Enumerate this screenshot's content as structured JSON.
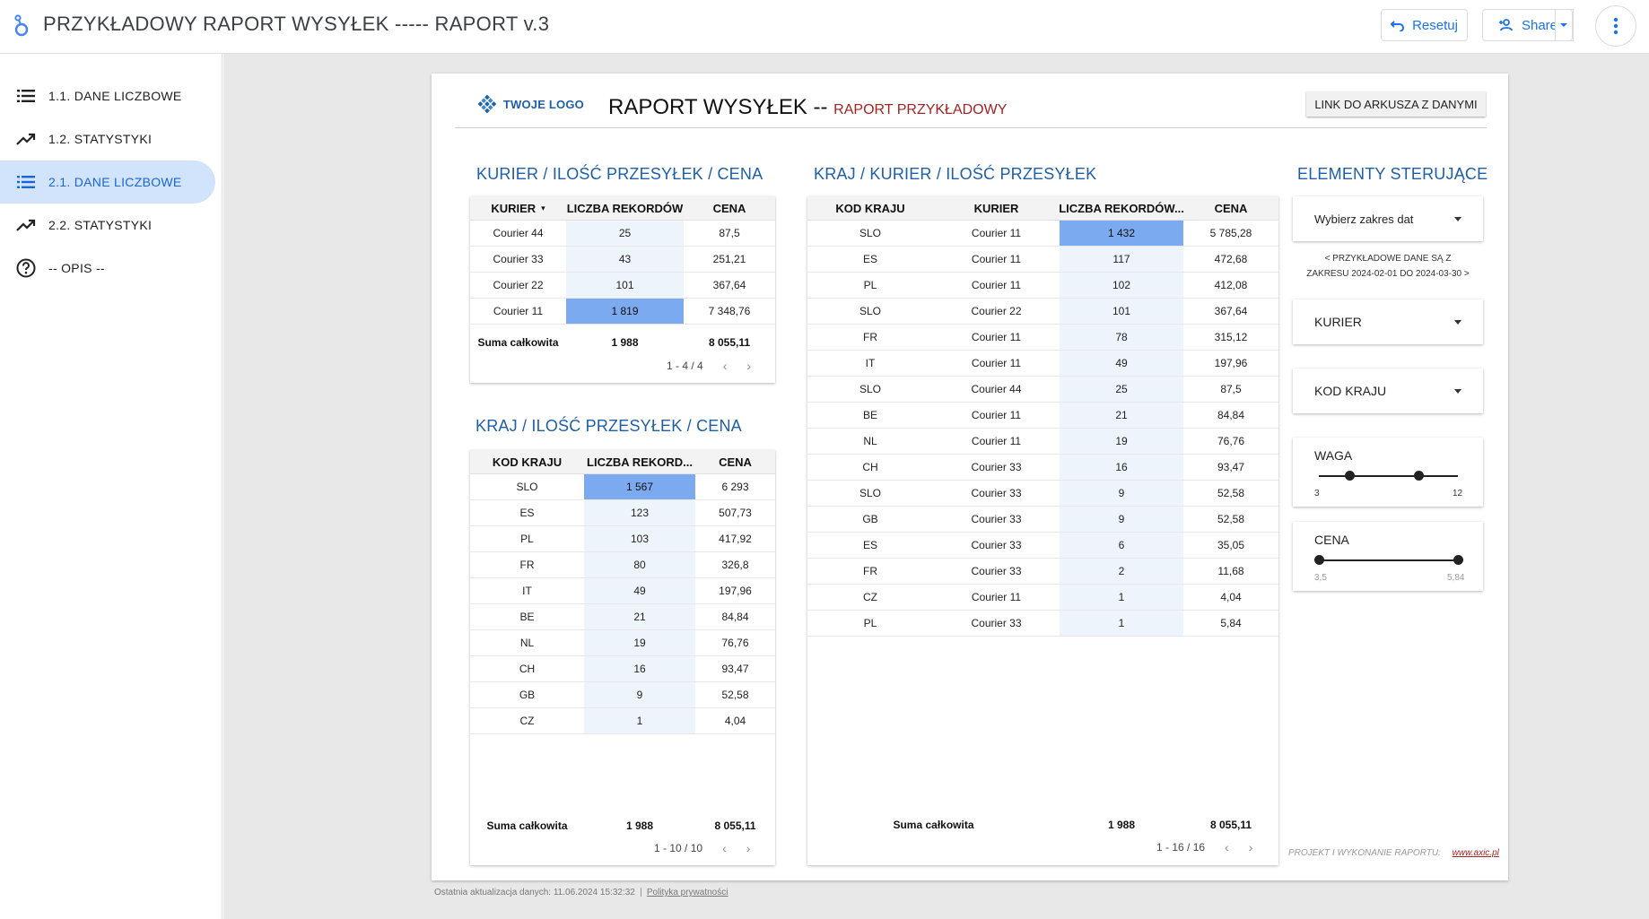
{
  "app": {
    "title": "PRZYKŁADOWY RAPORT WYSYŁEK ----- RAPORT v.3",
    "reset_label": "Resetuj",
    "share_label": "Share"
  },
  "sidebar": {
    "items": [
      {
        "label": "1.1. DANE LICZBOWE",
        "icon": "list-icon",
        "active": false
      },
      {
        "label": "1.2. STATYSTYKI",
        "icon": "trending-up-icon",
        "active": false
      },
      {
        "label": "2.1. DANE LICZBOWE",
        "icon": "list-icon",
        "active": true
      },
      {
        "label": "2.2. STATYSTYKI",
        "icon": "trending-up-icon",
        "active": false
      },
      {
        "label": "-- OPIS --",
        "icon": "help-circle-icon",
        "active": false
      }
    ]
  },
  "report": {
    "logo_text": "TWOJE LOGO",
    "title": "RAPORT WYSYŁEK --",
    "subtitle": "RAPORT PRZYKŁADOWY",
    "link_button": "LINK DO ARKUSZA Z DANYMI",
    "credits_label": "PROJEKT I WYKONANIE RAPORTU:",
    "credits_url": "www.axic.pl"
  },
  "table_courier": {
    "title": "KURIER / ILOŚĆ PRZESYŁEK / CENA",
    "headers": [
      "KURIER",
      "LICZBA REKORDÓW",
      "CENA"
    ],
    "sort_indicator": "▾",
    "rows": [
      [
        "Courier 44",
        "25",
        "87,5"
      ],
      [
        "Courier 33",
        "43",
        "251,21"
      ],
      [
        "Courier 22",
        "101",
        "367,64"
      ],
      [
        "Courier 11",
        "1 819",
        "7 348,76"
      ]
    ],
    "counts": [
      25,
      43,
      101,
      1819
    ],
    "total_label": "Suma całkowita",
    "total_count": "1 988",
    "total_price": "8 055,11",
    "pager": "1 - 4 / 4"
  },
  "table_country": {
    "title": "KRAJ / ILOŚĆ PRZESYŁEK / CENA",
    "headers": [
      "KOD KRAJU",
      "LICZBA REKORD...",
      "CENA"
    ],
    "rows": [
      [
        "SLO",
        "1 567",
        "6 293"
      ],
      [
        "ES",
        "123",
        "507,73"
      ],
      [
        "PL",
        "103",
        "417,92"
      ],
      [
        "FR",
        "80",
        "326,8"
      ],
      [
        "IT",
        "49",
        "197,96"
      ],
      [
        "BE",
        "21",
        "84,84"
      ],
      [
        "NL",
        "19",
        "76,76"
      ],
      [
        "CH",
        "16",
        "93,47"
      ],
      [
        "GB",
        "9",
        "52,58"
      ],
      [
        "CZ",
        "1",
        "4,04"
      ]
    ],
    "counts": [
      1567,
      123,
      103,
      80,
      49,
      21,
      19,
      16,
      9,
      1
    ],
    "total_label": "Suma całkowita",
    "total_count": "1 988",
    "total_price": "8 055,11",
    "pager": "1 - 10 / 10"
  },
  "table_country_courier": {
    "title": "KRAJ / KURIER / ILOŚĆ PRZESYŁEK",
    "headers": [
      "KOD KRAJU",
      "KURIER",
      "LICZBA REKORDÓW...",
      "CENA"
    ],
    "rows": [
      [
        "SLO",
        "Courier 11",
        "1 432",
        "5 785,28"
      ],
      [
        "ES",
        "Courier 11",
        "117",
        "472,68"
      ],
      [
        "PL",
        "Courier 11",
        "102",
        "412,08"
      ],
      [
        "SLO",
        "Courier 22",
        "101",
        "367,64"
      ],
      [
        "FR",
        "Courier 11",
        "78",
        "315,12"
      ],
      [
        "IT",
        "Courier 11",
        "49",
        "197,96"
      ],
      [
        "SLO",
        "Courier 44",
        "25",
        "87,5"
      ],
      [
        "BE",
        "Courier 11",
        "21",
        "84,84"
      ],
      [
        "NL",
        "Courier 11",
        "19",
        "76,76"
      ],
      [
        "CH",
        "Courier 33",
        "16",
        "93,47"
      ],
      [
        "SLO",
        "Courier 33",
        "9",
        "52,58"
      ],
      [
        "GB",
        "Courier 33",
        "9",
        "52,58"
      ],
      [
        "ES",
        "Courier 33",
        "6",
        "35,05"
      ],
      [
        "FR",
        "Courier 33",
        "2",
        "11,68"
      ],
      [
        "CZ",
        "Courier 11",
        "1",
        "4,04"
      ],
      [
        "PL",
        "Courier 33",
        "1",
        "5,84"
      ]
    ],
    "counts": [
      1432,
      117,
      102,
      101,
      78,
      49,
      25,
      21,
      19,
      16,
      9,
      9,
      6,
      2,
      1,
      1
    ],
    "total_label": "Suma całkowita",
    "total_count": "1 988",
    "total_price": "8 055,11",
    "pager": "1 - 16 / 16"
  },
  "controls": {
    "title": "ELEMENTY STERUJĄCE",
    "date_range": "Wybierz zakres dat",
    "note_line1": "< PRZYKŁADOWE DANE SĄ Z",
    "note_line2": "ZAKRESU 2024-02-01 DO 2024-03-30 >",
    "courier_dd": "KURIER",
    "country_dd": "KOD KRAJU",
    "weight": {
      "label": "WAGA",
      "min": "3",
      "max": "12",
      "min_value": 3,
      "max_value": 12,
      "low": 5,
      "high": 9.5
    },
    "price": {
      "label": "CENA",
      "min": "3,5",
      "max": "5,84",
      "min_value": 3.5,
      "max_value": 5.84,
      "low": 3.5,
      "high": 5.84
    }
  },
  "footer": {
    "updated": "Ostatnia aktualizacja danych: 11.06.2024 15:32:32",
    "privacy": "Polityka prywatności"
  },
  "colors": {
    "accent": "#1a73e8",
    "section_title": "#1f5fa8",
    "subtitle": "#a32323",
    "bar_max": "#7baaf0",
    "bar_light": "#eef4fc",
    "nav_active_bg": "#d2e3fc"
  }
}
